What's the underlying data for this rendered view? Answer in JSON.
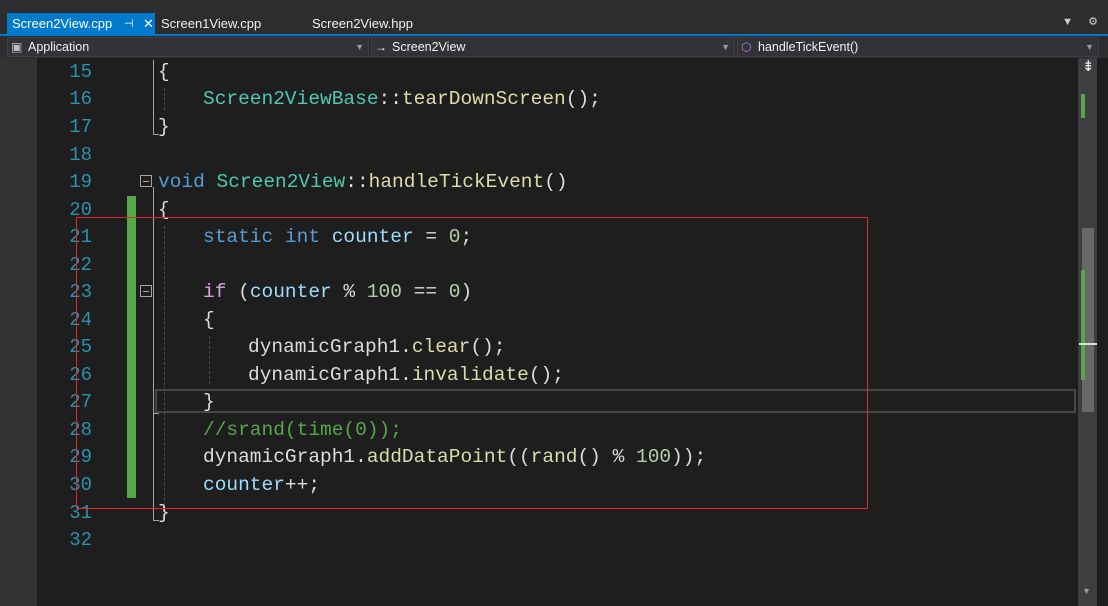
{
  "tabs": [
    {
      "label": "Screen2View.cpp",
      "active": true
    },
    {
      "label": "Screen1View.cpp",
      "active": false
    },
    {
      "label": "Screen2View.hpp",
      "active": false
    }
  ],
  "tab_icons": {
    "pin": "pin-icon",
    "close": "close-icon",
    "overflow": "chevron-down-icon",
    "settings": "gear-icon"
  },
  "navbar": {
    "project": "Application",
    "scope": "Screen2View",
    "member": "handleTickEvent()"
  },
  "editor": {
    "line_numbers": [
      "15",
      "16",
      "17",
      "18",
      "19",
      "20",
      "21",
      "22",
      "23",
      "24",
      "25",
      "26",
      "27",
      "28",
      "29",
      "30",
      "31",
      "32"
    ],
    "lines": {
      "l15": {
        "brace": "{"
      },
      "l16": {
        "type": "Screen2ViewBase",
        "sep": "::",
        "fn": "tearDownScreen",
        "rest": "();"
      },
      "l17": {
        "brace": "}"
      },
      "l19": {
        "kw": "void",
        "type": "Screen2View",
        "sep": "::",
        "fn": "handleTickEvent",
        "rest": "()"
      },
      "l20": {
        "brace": "{"
      },
      "l21": {
        "kw1": "static",
        "kw2": "int",
        "var": "counter",
        "op": " = ",
        "num": "0",
        "end": ";"
      },
      "l23": {
        "ctl": "if",
        "open": " (",
        "var": "counter",
        "op": " % ",
        "num1": "100",
        "op2": " == ",
        "num2": "0",
        "close": ")"
      },
      "l24": {
        "brace": "{"
      },
      "l25": {
        "obj": "dynamicGraph1",
        "dot": ".",
        "fn": "clear",
        "rest": "();"
      },
      "l26": {
        "obj": "dynamicGraph1",
        "dot": ".",
        "fn": "invalidate",
        "rest": "();"
      },
      "l27": {
        "brace": "}"
      },
      "l28": {
        "comment": "//srand(time(0));"
      },
      "l29": {
        "obj": "dynamicGraph1",
        "dot": ".",
        "fn1": "addDataPoint",
        "p1": "((",
        "fn2": "rand",
        "p2": "() % ",
        "num": "100",
        "p3": "));"
      },
      "l30": {
        "var": "counter",
        "rest": "++;"
      },
      "l31": {
        "brace": "}"
      }
    }
  },
  "colors": {
    "keyword": "#569cd6",
    "control": "#d8a0df",
    "type": "#4ec9b0",
    "function": "#dcdcaa",
    "variable": "#9cdcfe",
    "number": "#b5cea8",
    "comment": "#57a64a",
    "line_number": "#2b91af",
    "change_marker": "#57a64a",
    "highlight_box": "#e0272c",
    "accent": "#007acc"
  }
}
